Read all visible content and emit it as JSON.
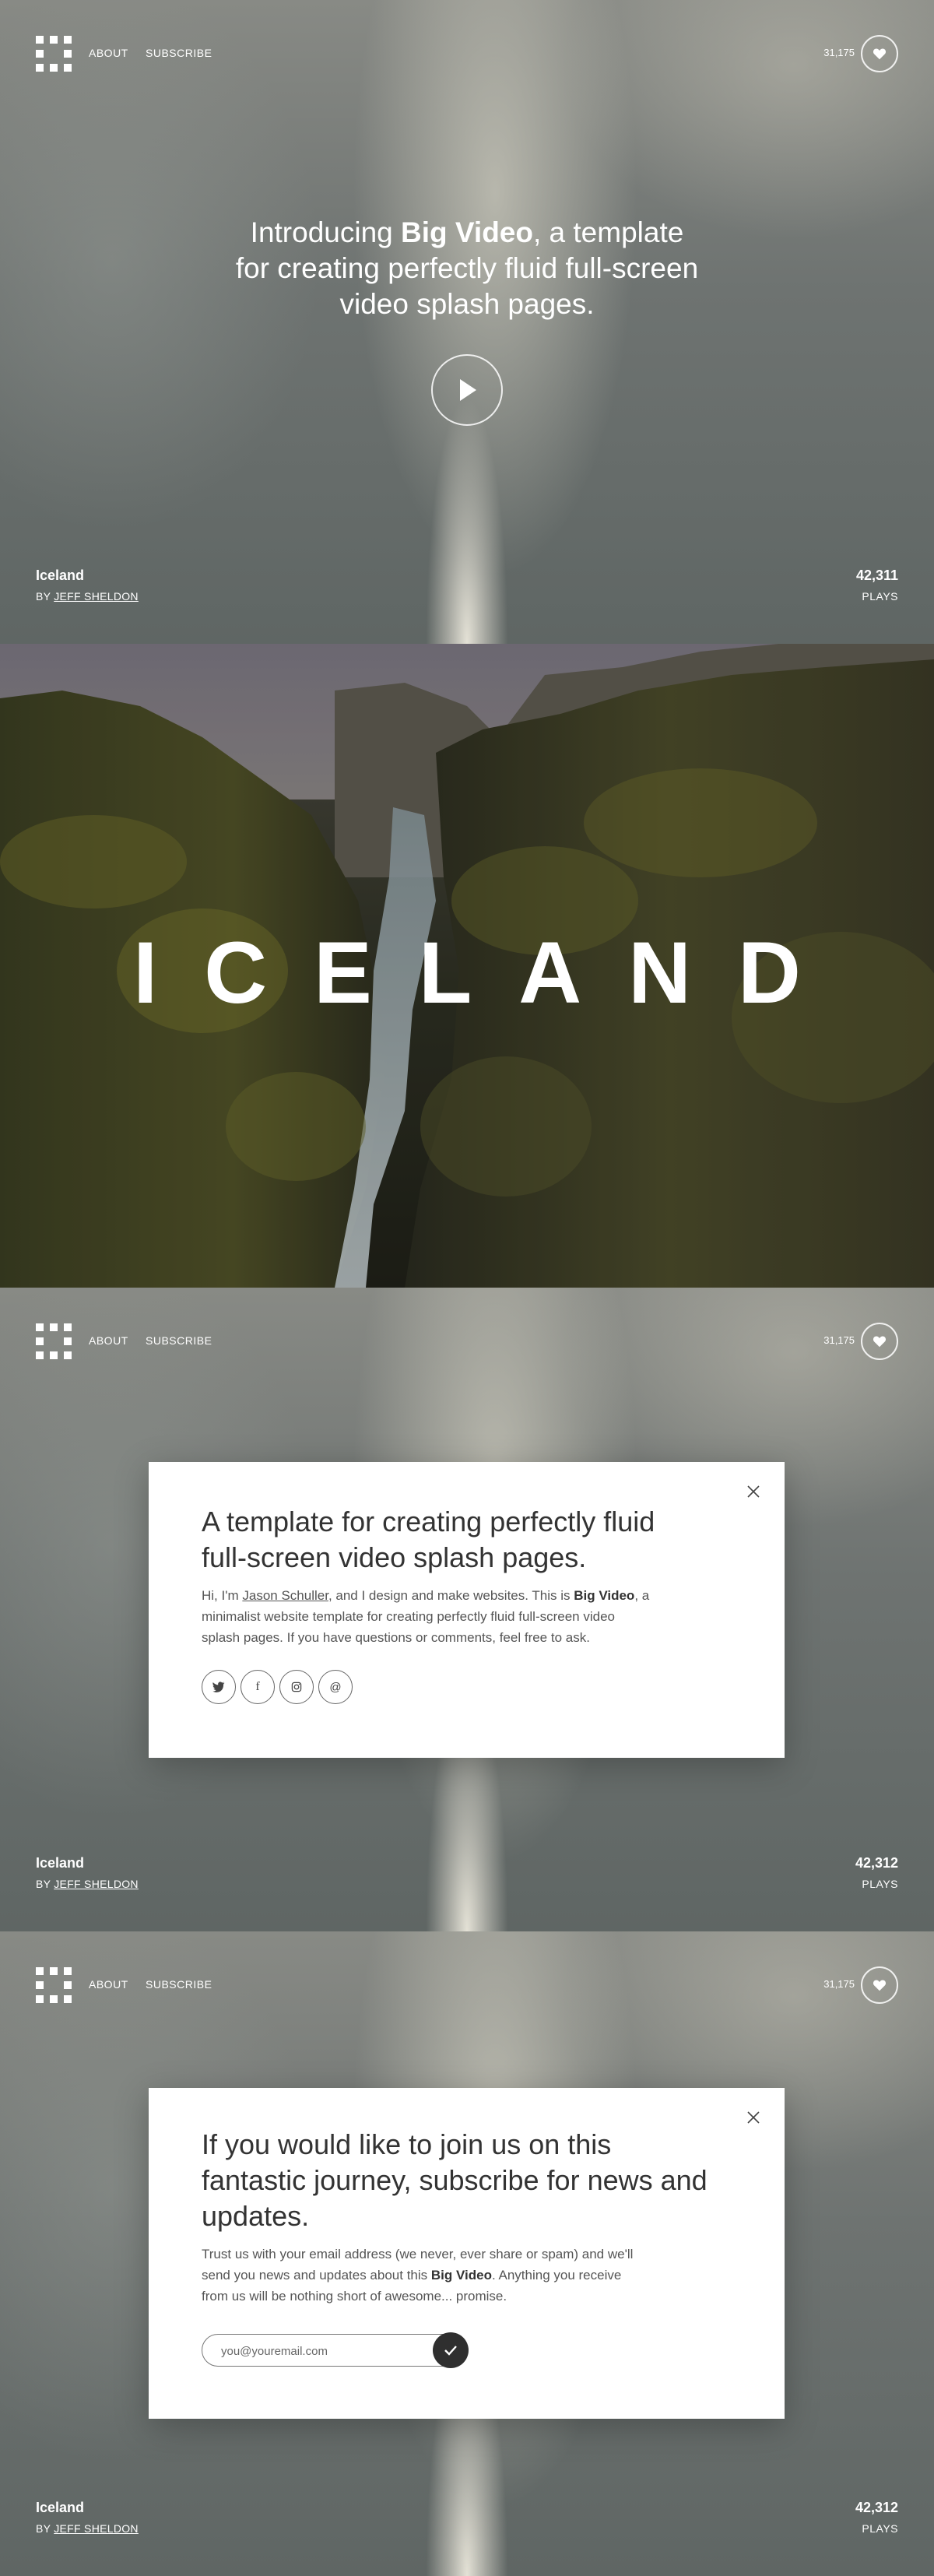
{
  "nav": {
    "about": "ABOUT",
    "subscribe": "SUBSCRIBE"
  },
  "likes": "31,175",
  "hero": {
    "intro_before": "Introducing ",
    "intro_bold": "Big Video",
    "intro_after": ", a template",
    "line2": "for creating perfectly fluid full-screen",
    "line3": "video splash pages."
  },
  "video_info": {
    "title": "Iceland",
    "by": "BY ",
    "author": "JEFF SHELDON",
    "plays_label": "PLAYS",
    "plays_1": "42,311",
    "plays_2": "42,312",
    "plays_3": "42,312"
  },
  "iceland": {
    "word": "ICELAND"
  },
  "about_modal": {
    "heading_line1": "A template for creating perfectly fluid",
    "heading_line2": "full-screen video splash pages.",
    "body_1": "Hi, I'm ",
    "author_link": "Jason Schuller",
    "body_2": ", and I design and make websites. This is ",
    "body_bold": "Big Video",
    "body_3": ", a",
    "body_4": "minimalist website template for creating perfectly fluid full-screen video",
    "body_5": "splash pages. If you have questions or comments, feel free to ask.",
    "social": [
      {
        "icon": "twitter-icon",
        "glyph": "t"
      },
      {
        "icon": "facebook-icon",
        "glyph": "f"
      },
      {
        "icon": "instagram-icon",
        "glyph": "◙"
      },
      {
        "icon": "email-icon",
        "glyph": "@"
      }
    ]
  },
  "subscribe_modal": {
    "heading_line1": "If you would like to join us on this",
    "heading_line2": "fantastic journey, subscribe for news and",
    "heading_line3": "updates.",
    "body_1": "Trust us with your email address (we never, ever share or spam) and we'll",
    "body_2": "send you news and updates about this ",
    "body_bold": "Big Video",
    "body_3": ". Anything you receive",
    "body_4": "from us will be nothing short of awesome... promise.",
    "email_placeholder": "you@youremail.com"
  },
  "colors": {
    "accent_dark": "#2f2f2f",
    "text_white": "#ffffff"
  }
}
